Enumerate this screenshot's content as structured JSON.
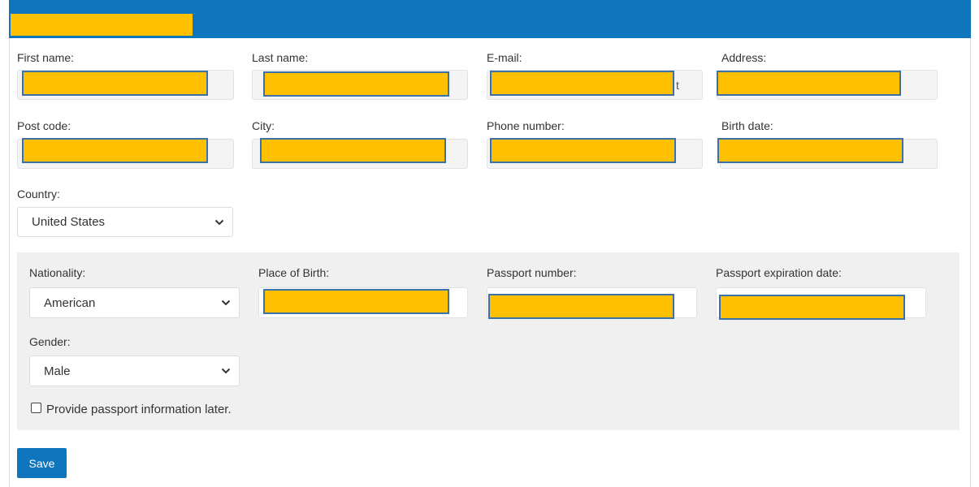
{
  "form": {
    "labels": {
      "first_name": "First name:",
      "last_name": "Last name:",
      "email": "E-mail:",
      "address": "Address:",
      "post_code": "Post code:",
      "city": "City:",
      "phone": "Phone number:",
      "birth_date": "Birth date:",
      "country": "Country:"
    },
    "email_visible_tail": "t",
    "country_value": "United States"
  },
  "passport": {
    "labels": {
      "nationality": "Nationality:",
      "place_of_birth": "Place of Birth:",
      "passport_number": "Passport number:",
      "passport_expiration": "Passport expiration date:",
      "gender": "Gender:"
    },
    "nationality_value": "American",
    "gender_value": "Male",
    "later_checkbox_label": "Provide passport information later.",
    "later_checked": false
  },
  "actions": {
    "save_label": "Save"
  },
  "colors": {
    "header": "#0f75bc",
    "redaction": "#ffc000",
    "button": "#0f75bc"
  }
}
